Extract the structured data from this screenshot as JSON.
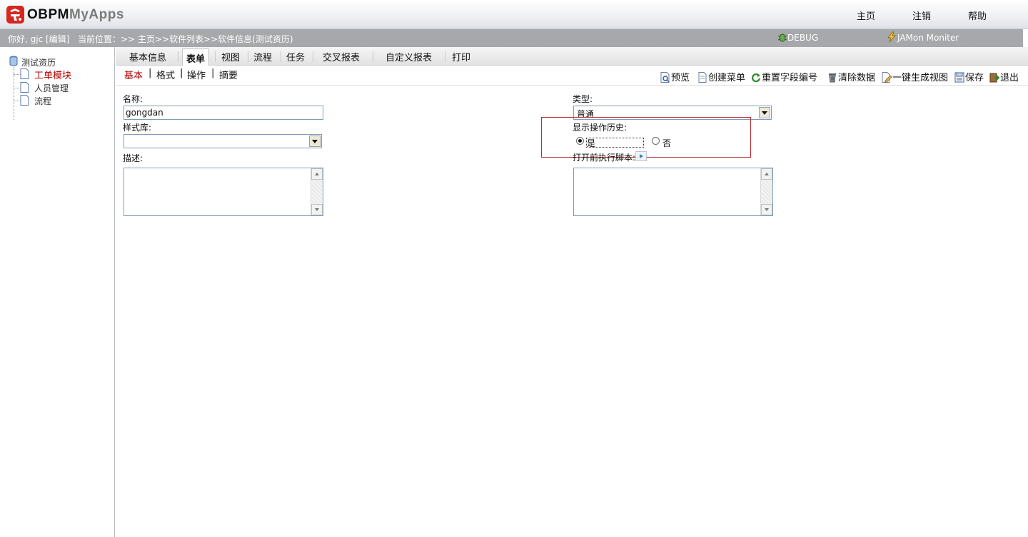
{
  "header": {
    "logo_primary": "OBPM",
    "logo_secondary": "MyApps",
    "links": [
      "主页",
      "注销",
      "帮助"
    ]
  },
  "infobar": {
    "greeting": "你好, gjc [编辑]",
    "location": "当前位置：>> 主页>>软件列表>>软件信息(测试资历)",
    "debug_label": "DEBUG",
    "jamon_label": "JAMon Moniter"
  },
  "sidebar": {
    "root": "测试资历",
    "items": [
      {
        "label": "工单模块",
        "active": true
      },
      {
        "label": "人员管理",
        "active": false
      },
      {
        "label": "流程",
        "active": false
      }
    ]
  },
  "tabs": [
    "基本信息",
    "表单",
    "视图",
    "流程",
    "任务",
    "交叉报表",
    "自定义报表",
    "打印"
  ],
  "active_tab": "表单",
  "subtabs": [
    "基本",
    "格式",
    "操作",
    "摘要"
  ],
  "toolbar": {
    "preview": "预览",
    "create_menu": "创建菜单",
    "reset_field_numbers": "重置字段编号",
    "clear_data": "清除数据",
    "generate_view": "一键生成视图",
    "save": "保存",
    "exit": "退出"
  },
  "form": {
    "name_label": "名称:",
    "name_value": "gongdan",
    "type_label": "类型:",
    "type_value": "普通",
    "style_label": "样式库:",
    "style_value": "",
    "history_label": "显示操作历史:",
    "history_yes": "是",
    "history_no": "否",
    "history_selected": "是",
    "desc_label": "描述:",
    "script_label": "打开前执行脚本:"
  },
  "colors": {
    "accent_red": "#b30000",
    "infobar_gray": "#a6a8ab",
    "highlight_box": "#c0272d"
  }
}
